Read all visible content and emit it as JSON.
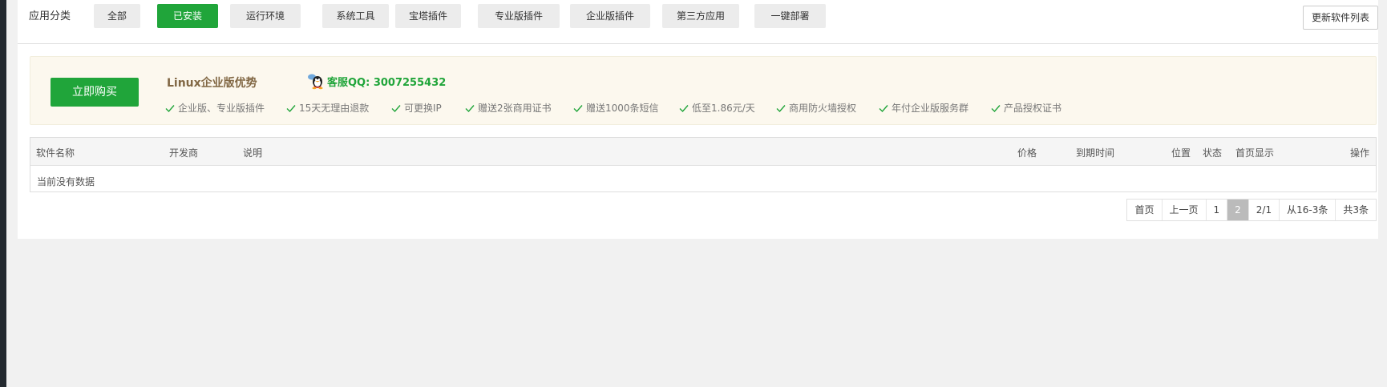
{
  "categories": {
    "label": "应用分类",
    "items": [
      {
        "label": "全部",
        "active": false
      },
      {
        "label": "已安装",
        "active": true
      },
      {
        "label": "运行环境",
        "active": false
      },
      {
        "label": "系统工具",
        "active": false
      },
      {
        "label": "宝塔插件",
        "active": false
      },
      {
        "label": "专业版插件",
        "active": false
      },
      {
        "label": "企业版插件",
        "active": false
      },
      {
        "label": "第三方应用",
        "active": false
      },
      {
        "label": "一键部署",
        "active": false
      }
    ],
    "refresh_label": "更新软件列表"
  },
  "promo": {
    "buy_label": "立即购买",
    "title": "Linux企业版优势",
    "qq_label": "客服QQ: 3007255432",
    "features": [
      "企业版、专业版插件",
      "15天无理由退款",
      "可更换IP",
      "赠送2张商用证书",
      "赠送1000条短信",
      "低至1.86元/天",
      "商用防火墙授权",
      "年付企业版服务群",
      "产品授权证书"
    ]
  },
  "table": {
    "headers": {
      "name": "软件名称",
      "developer": "开发商",
      "description": "说明",
      "price": "价格",
      "expiry": "到期时间",
      "location": "位置",
      "status": "状态",
      "homepage": "首页显示",
      "actions": "操作"
    },
    "empty_text": "当前没有数据"
  },
  "pagination": {
    "first": "首页",
    "prev": "上一页",
    "page1": "1",
    "page2": "2",
    "page_ratio": "2/1",
    "range": "从16-3条",
    "total": "共3条"
  },
  "colors": {
    "accent": "#20a53a",
    "promo_bg": "#fcf8ee",
    "promo_title": "#816743"
  }
}
